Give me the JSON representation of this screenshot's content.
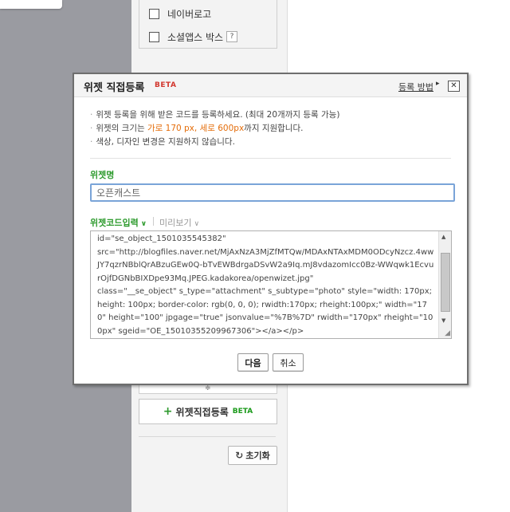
{
  "sidebar": {
    "items": [
      {
        "label": "네이버로고"
      },
      {
        "label": "소셜앱스 박스",
        "help": "?"
      }
    ],
    "add_widget_label": "위젯직접등록",
    "add_widget_badge": "BETA",
    "reset_label": "초기화"
  },
  "dialog": {
    "title": "위젯 직접등록",
    "title_badge": "BETA",
    "help_link": "등록 방법",
    "close_glyph": "✕",
    "notes": {
      "line1": "위젯 등록을 위해 받은 코드를 등록하세요. (최대 20개까지 등록 가능)",
      "line2_prefix": "위젯의 크기는 ",
      "line2_highlight": "가로 170 px, 세로 600px",
      "line2_suffix": "까지 지원합니다.",
      "line3": "색상, 디자인 변경은 지원하지 않습니다."
    },
    "name_label": "위젯명",
    "name_value": "오픈캐스트",
    "tabs": {
      "code": "위젯코드입력",
      "preview": "미리보기"
    },
    "code": {
      "line1": "id=\"se_object_1501035545382\"",
      "line2": "src=\"http://blogfiles.naver.net/MjAxNzA3MjZfMTQw/MDAxNTAxMDM0ODcyNzcz.4wwJY7qzrNBblQrABzuGEw0Q-bTvEWBdrgaDSvW2a9Iq.mJ8vdazomIcc0Bz-WWqwk1EcvurOjfDGNbBIXDpe93Mq.JPEG.kadakorea/openwizet.jpg\"",
      "line3": "class=\"__se_object\" s_type=\"attachment\" s_subtype=\"photo\" style=\"width: 170px; height: 100px; border-color: rgb(0, 0, 0); rwidth:170px; rheight:100px;\" width=\"170\" height=\"100\" jpgage=\"true\" jsonvalue=\"%7B%7D\" rwidth=\"170px\" rheight=\"100px\" sgeid=\"OE_15010355209967306\"></a></p>"
    },
    "buttons": {
      "next": "다음",
      "cancel": "취소"
    }
  },
  "colors": {
    "accent_green": "#2c9a2c",
    "beta_red": "#d2372e",
    "highlight_orange": "#e46d0a",
    "focus_blue": "#7aa4d8"
  }
}
